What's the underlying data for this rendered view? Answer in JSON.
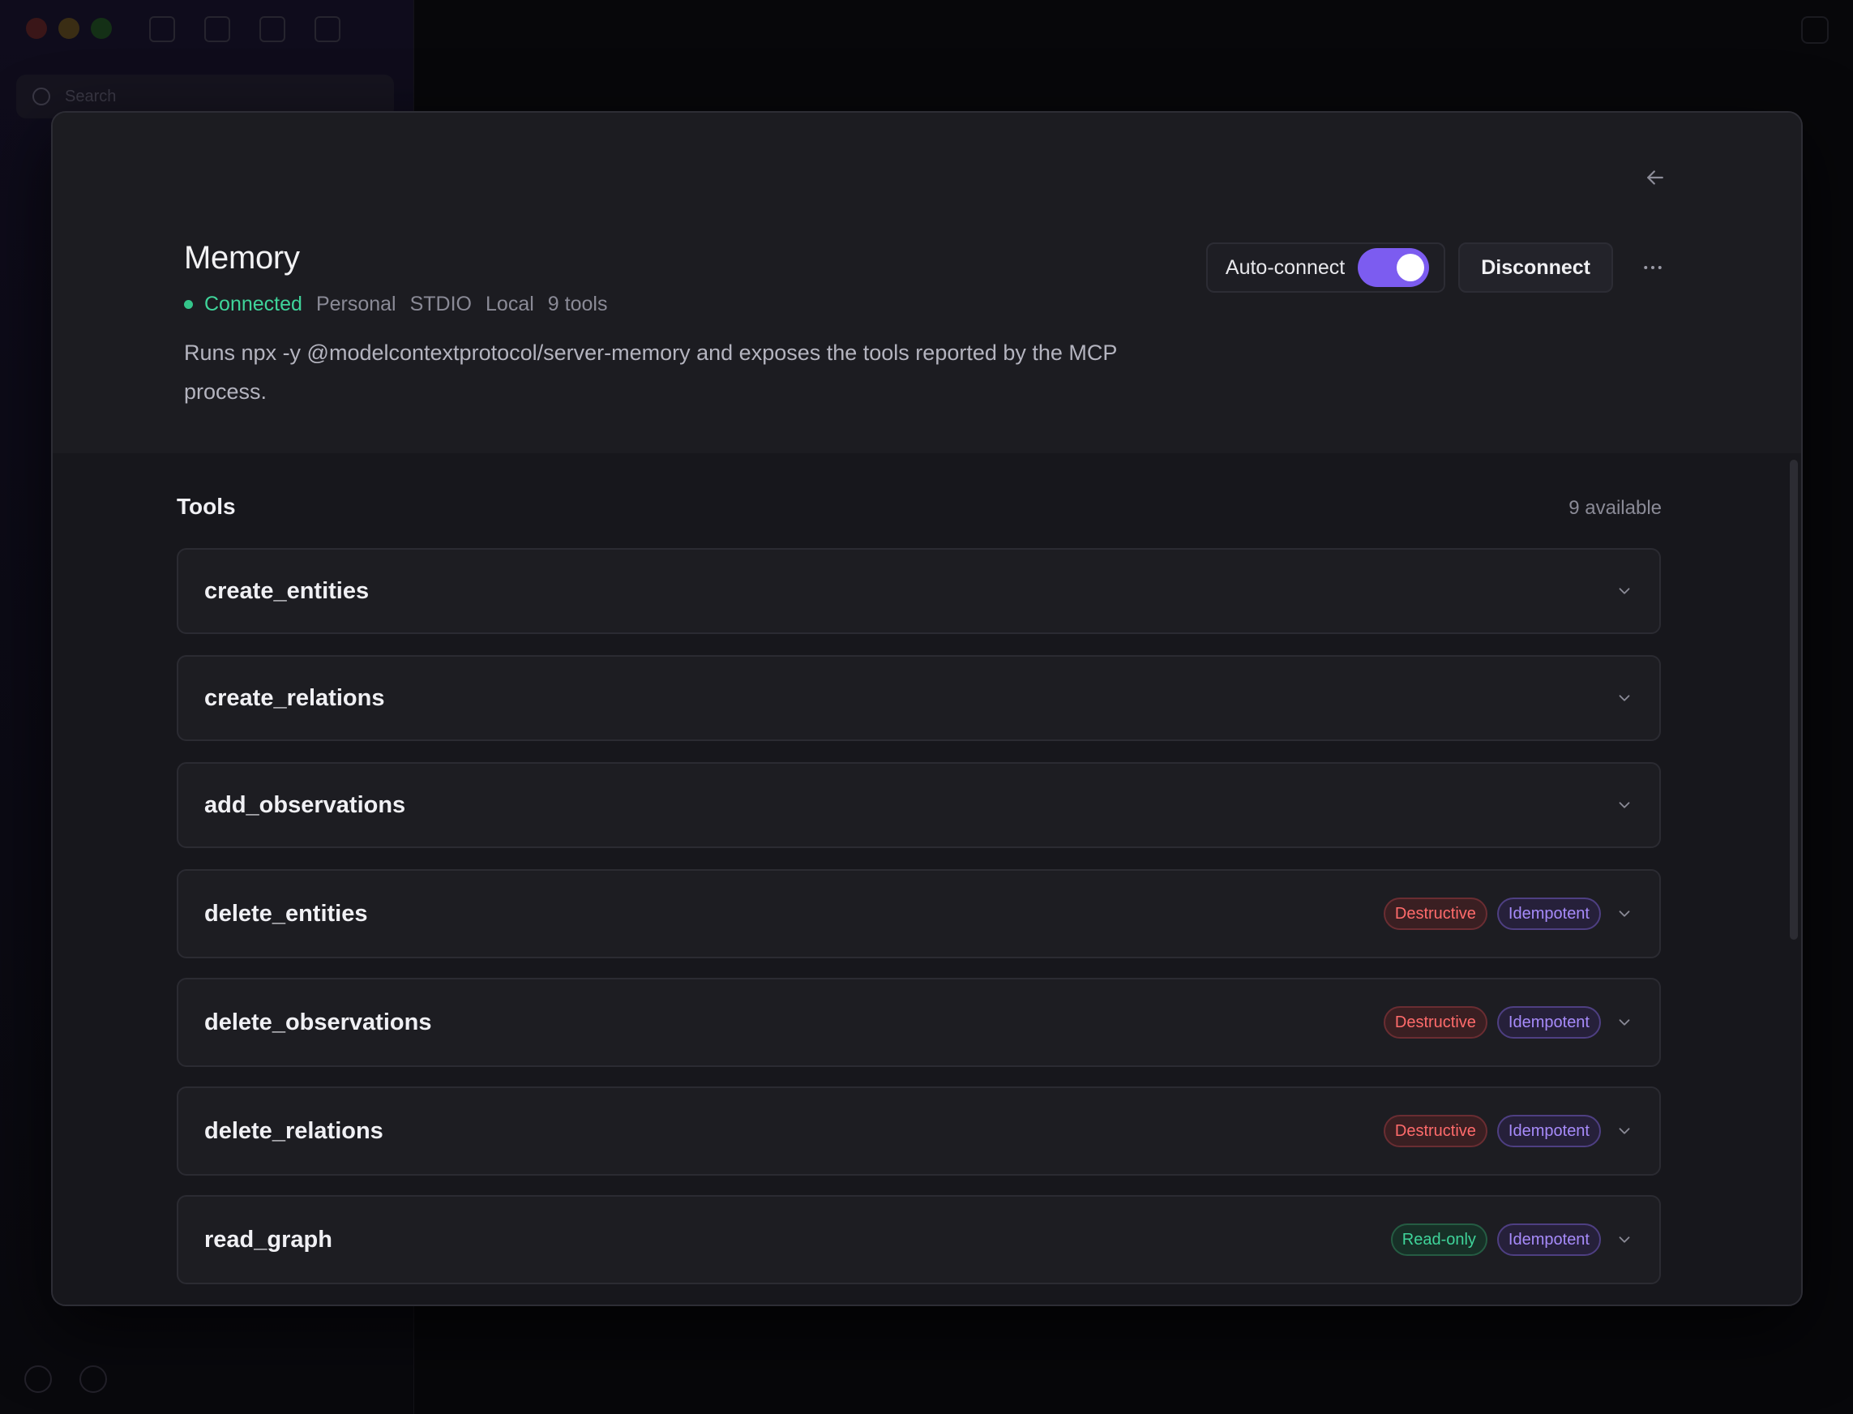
{
  "background": {
    "search_placeholder": "Search"
  },
  "server": {
    "name": "Memory",
    "status": "Connected",
    "tags": [
      "Personal",
      "STDIO",
      "Local",
      "9 tools"
    ],
    "description": "Runs npx -y @modelcontextprotocol/server-memory and exposes the tools reported by the MCP process."
  },
  "actions": {
    "auto_connect_label": "Auto-connect",
    "auto_connect_enabled": true,
    "disconnect_label": "Disconnect",
    "more_label": "···"
  },
  "tools": {
    "heading": "Tools",
    "count_label": "9 available",
    "items": [
      {
        "name": "create_entities",
        "badges": []
      },
      {
        "name": "create_relations",
        "badges": []
      },
      {
        "name": "add_observations",
        "badges": []
      },
      {
        "name": "delete_entities",
        "badges": [
          "Destructive",
          "Idempotent"
        ]
      },
      {
        "name": "delete_observations",
        "badges": [
          "Destructive",
          "Idempotent"
        ]
      },
      {
        "name": "delete_relations",
        "badges": [
          "Destructive",
          "Idempotent"
        ]
      },
      {
        "name": "read_graph",
        "badges": [
          "Read-only",
          "Idempotent"
        ]
      }
    ]
  },
  "colors": {
    "accent": "#7c5cf0",
    "connected": "#3fd49a",
    "destructive": "#ff6b6b",
    "idempotent": "#a78bfa",
    "readonly": "#3fd49a"
  },
  "icons": {
    "back": "arrow-left-icon",
    "more": "more-horizontal-icon",
    "expand": "chevron-down-icon"
  }
}
